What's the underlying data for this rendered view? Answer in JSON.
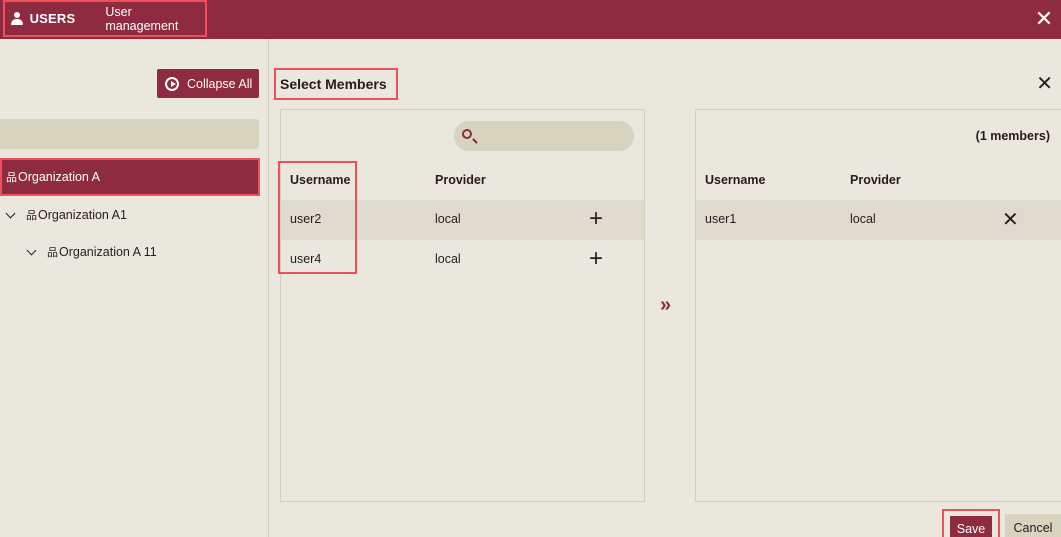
{
  "header": {
    "app_title": "USERS",
    "subtitle": "User management",
    "icons": {
      "user": "user-icon",
      "close": "close-icon"
    },
    "close_glyph": "✕"
  },
  "sidebar": {
    "collapse_label": "Collapse All",
    "search_placeholder": "",
    "tree": [
      {
        "label": "Organization A",
        "selected": true,
        "level": 0
      },
      {
        "label": "Organization A1",
        "selected": false,
        "level": 1,
        "expanded": true
      },
      {
        "label": "Organization A 11",
        "selected": false,
        "level": 2,
        "expanded": true
      }
    ],
    "org_icon_glyph": "品"
  },
  "main": {
    "title": "Select Members",
    "close_glyph": "✕",
    "available": {
      "search_value": "",
      "search_placeholder": "",
      "columns": [
        "Username",
        "Provider"
      ],
      "rows": [
        {
          "username": "user2",
          "provider": "local",
          "action": "+"
        },
        {
          "username": "user4",
          "provider": "local",
          "action": "+"
        }
      ]
    },
    "transfer_glyph": "»",
    "selected": {
      "count_label": "(1 members)",
      "columns": [
        "Username",
        "Provider"
      ],
      "rows": [
        {
          "username": "user1",
          "provider": "local",
          "action": "✕"
        }
      ]
    },
    "buttons": {
      "save": "Save",
      "cancel": "Cancel"
    }
  },
  "colors": {
    "accent": "#8e2b40",
    "background": "#eae7df",
    "highlight": "#f0505a",
    "muted": "#d6d3bf"
  }
}
